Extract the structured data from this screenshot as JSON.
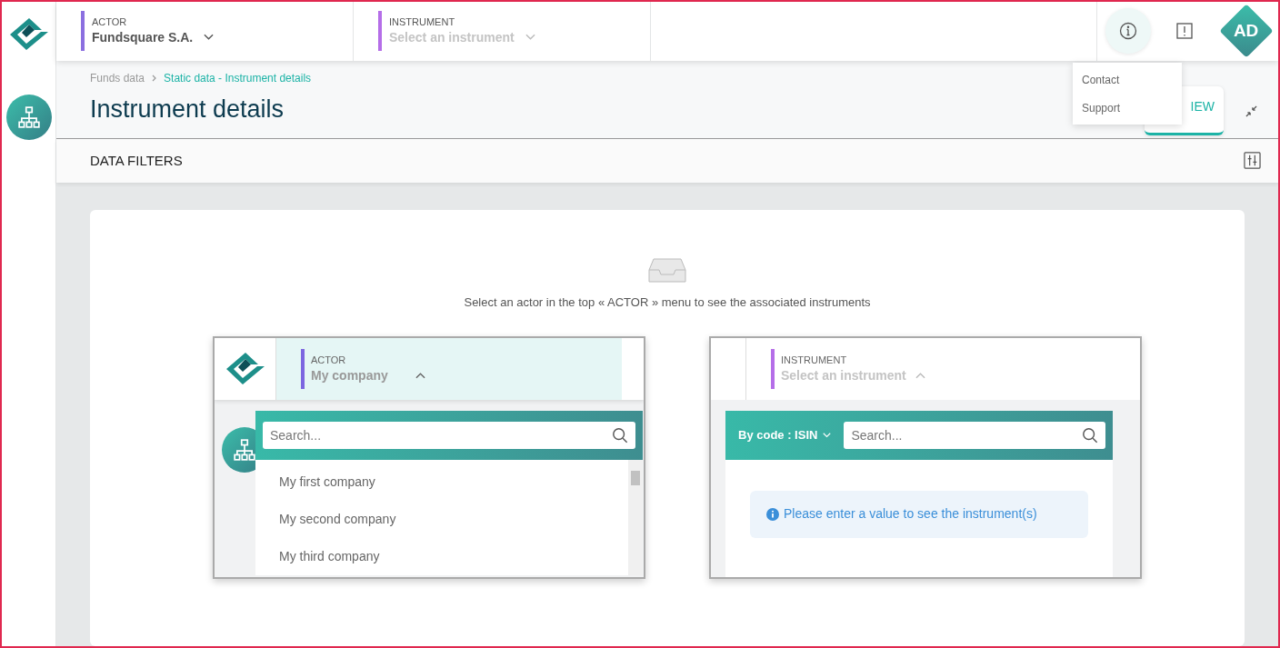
{
  "top_bar": {
    "selectors": [
      {
        "label": "ACTOR",
        "value": "Fundsquare S.A.",
        "expanded": false,
        "color": "#8b6fe0"
      },
      {
        "label": "INSTRUMENT",
        "placeholder": "Select an instrument",
        "expanded": false,
        "color": "#b56ee8"
      }
    ],
    "info_button": {
      "selected": true
    },
    "avatar": "AD",
    "info_menu": [
      "Contact",
      "Support"
    ]
  },
  "breadcrumb": [
    "Funds data",
    "Static data - Instrument details"
  ],
  "title": "Instrument details",
  "view_button": "IEW",
  "data_filters": "DATA FILTERS",
  "empty_message": "Select an actor in the top « ACTOR » menu to see the associated instruments",
  "actor_preview": {
    "label": "ACTOR",
    "value": "My company",
    "expanded": true,
    "search_placeholder": "Search...",
    "options": [
      "My first company",
      "My second company",
      "My third company"
    ]
  },
  "instrument_preview": {
    "label": "INSTRUMENT",
    "placeholder": "Select an instrument",
    "expanded": true,
    "code_selector": "By code : ISIN",
    "search_placeholder": "Search...",
    "message": "Please enter a value to see the instrument(s)"
  }
}
